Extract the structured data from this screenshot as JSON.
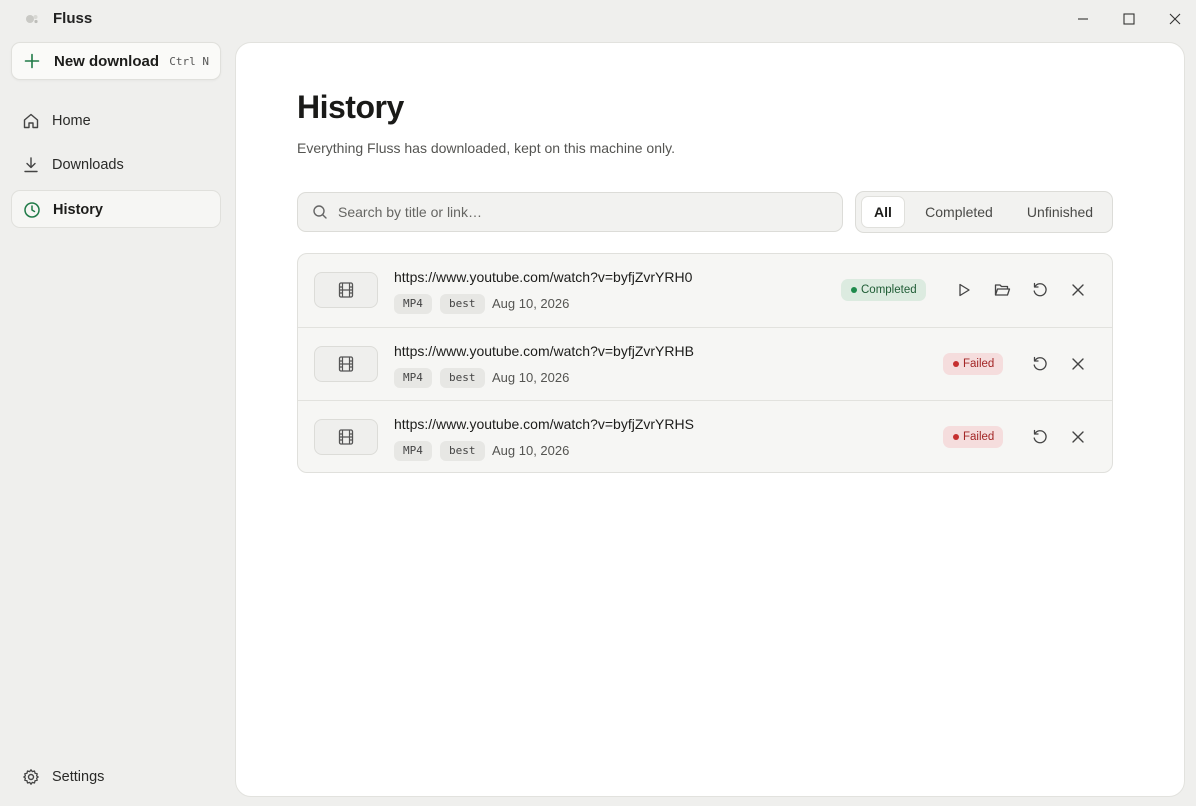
{
  "app": {
    "title": "Fluss"
  },
  "sidebar": {
    "new_download": {
      "label": "New download",
      "shortcut": "Ctrl N"
    },
    "items": [
      {
        "label": "Home",
        "icon": "home-icon",
        "active": false
      },
      {
        "label": "Downloads",
        "icon": "download-icon",
        "active": false
      },
      {
        "label": "History",
        "icon": "clock-icon",
        "active": true
      }
    ],
    "settings": {
      "label": "Settings",
      "icon": "gear-icon"
    }
  },
  "main": {
    "title": "History",
    "subtitle": "Everything Fluss has downloaded, kept on this machine only.",
    "search": {
      "placeholder": "Search by title or link…",
      "value": ""
    },
    "filters": {
      "all": "All",
      "completed": "Completed",
      "unfinished": "Unfinished",
      "selected": "All"
    },
    "rows": [
      {
        "url": "https://www.youtube.com/watch?v=byfjZvrYRH0",
        "format": "MP4",
        "quality": "best",
        "date": "Aug 10, 2026",
        "status": "Completed"
      },
      {
        "url": "https://www.youtube.com/watch?v=byfjZvrYRHB",
        "format": "MP4",
        "quality": "best",
        "date": "Aug 10, 2026",
        "status": "Failed"
      },
      {
        "url": "https://www.youtube.com/watch?v=byfjZvrYRHS",
        "format": "MP4",
        "quality": "best",
        "date": "Aug 10, 2026",
        "status": "Failed"
      }
    ]
  },
  "colors": {
    "accent": "#1f7a47",
    "completed_bg": "#dcebe0",
    "failed_bg": "#f5dddd",
    "failed_text": "#a32626"
  }
}
